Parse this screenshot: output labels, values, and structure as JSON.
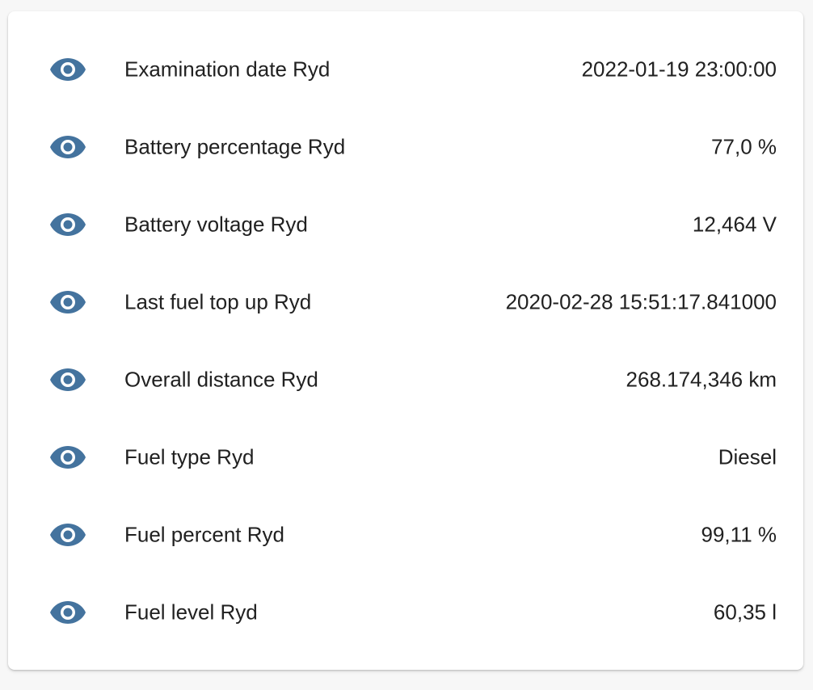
{
  "colors": {
    "icon": "#44739e",
    "text": "#212121",
    "card_background": "#ffffff",
    "page_background": "#f7f7f7"
  },
  "entities": [
    {
      "icon": "eye-icon",
      "label": "Examination date Ryd",
      "value": "2022-01-19 23:00:00"
    },
    {
      "icon": "eye-icon",
      "label": "Battery percentage Ryd",
      "value": "77,0 %"
    },
    {
      "icon": "eye-icon",
      "label": "Battery voltage Ryd",
      "value": "12,464 V"
    },
    {
      "icon": "eye-icon",
      "label": "Last fuel top up Ryd",
      "value": "2020-02-28 15:51:17.841000"
    },
    {
      "icon": "eye-icon",
      "label": "Overall distance Ryd",
      "value": "268.174,346 km"
    },
    {
      "icon": "eye-icon",
      "label": "Fuel type Ryd",
      "value": "Diesel"
    },
    {
      "icon": "eye-icon",
      "label": "Fuel percent Ryd",
      "value": "99,11 %"
    },
    {
      "icon": "eye-icon",
      "label": "Fuel level Ryd",
      "value": "60,35 l"
    }
  ]
}
